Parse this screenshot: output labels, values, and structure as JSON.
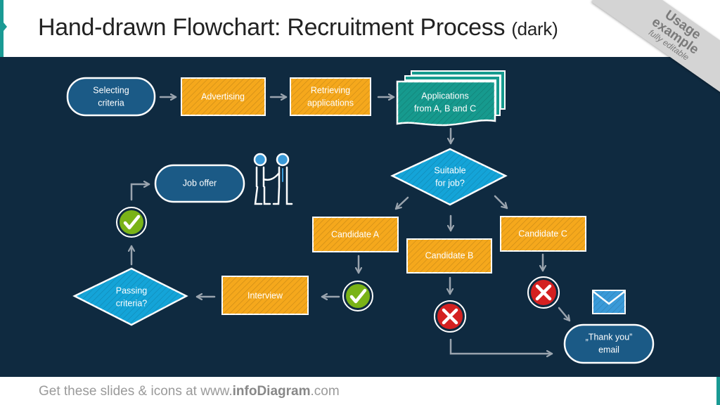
{
  "header": {
    "title": "Hand-drawn Flowchart: Recruitment Process",
    "title_suffix": "(dark)"
  },
  "ribbon": {
    "line1": "Usage",
    "line2": "example",
    "line3": "fully editable"
  },
  "footer": {
    "prefix": "Get these slides & icons at www.",
    "brand": "infoDiagram",
    "suffix": ".com"
  },
  "colors": {
    "background": "#0f2a40",
    "terminal": "#1b5a86",
    "process": "#f5a81c",
    "document": "#169a8e",
    "decision": "#14a4d8",
    "check": "#7ab317",
    "cross": "#d42020",
    "arrow": "#9aa4ae",
    "accent": "#1a9a94"
  },
  "nodes": {
    "selecting": {
      "line1": "Selecting",
      "line2": "criteria",
      "type": "terminal"
    },
    "advertising": {
      "line1": "Advertising",
      "type": "process"
    },
    "retrieving": {
      "line1": "Retrieving",
      "line2": "applications",
      "type": "process"
    },
    "applications": {
      "line1": "Applications",
      "line2": "from A, B and C",
      "type": "document"
    },
    "suitable": {
      "line1": "Suitable",
      "line2": "for job?",
      "type": "decision"
    },
    "candidate_a": {
      "line1": "Candidate A",
      "type": "process"
    },
    "candidate_b": {
      "line1": "Candidate B",
      "type": "process"
    },
    "candidate_c": {
      "line1": "Candidate C",
      "type": "process"
    },
    "interview": {
      "line1": "Interview",
      "type": "process"
    },
    "passing": {
      "line1": "Passing",
      "line2": "criteria?",
      "type": "decision"
    },
    "job_offer": {
      "line1": "Job offer",
      "type": "terminal"
    },
    "thank_you": {
      "line1": "„Thank you”",
      "line2": "email",
      "type": "terminal"
    }
  },
  "icons": {
    "check_a": "check-icon",
    "check_passing": "check-icon",
    "cross_b": "cross-icon",
    "cross_c": "cross-icon",
    "handshake": "handshake-icon",
    "envelope": "envelope-icon"
  }
}
